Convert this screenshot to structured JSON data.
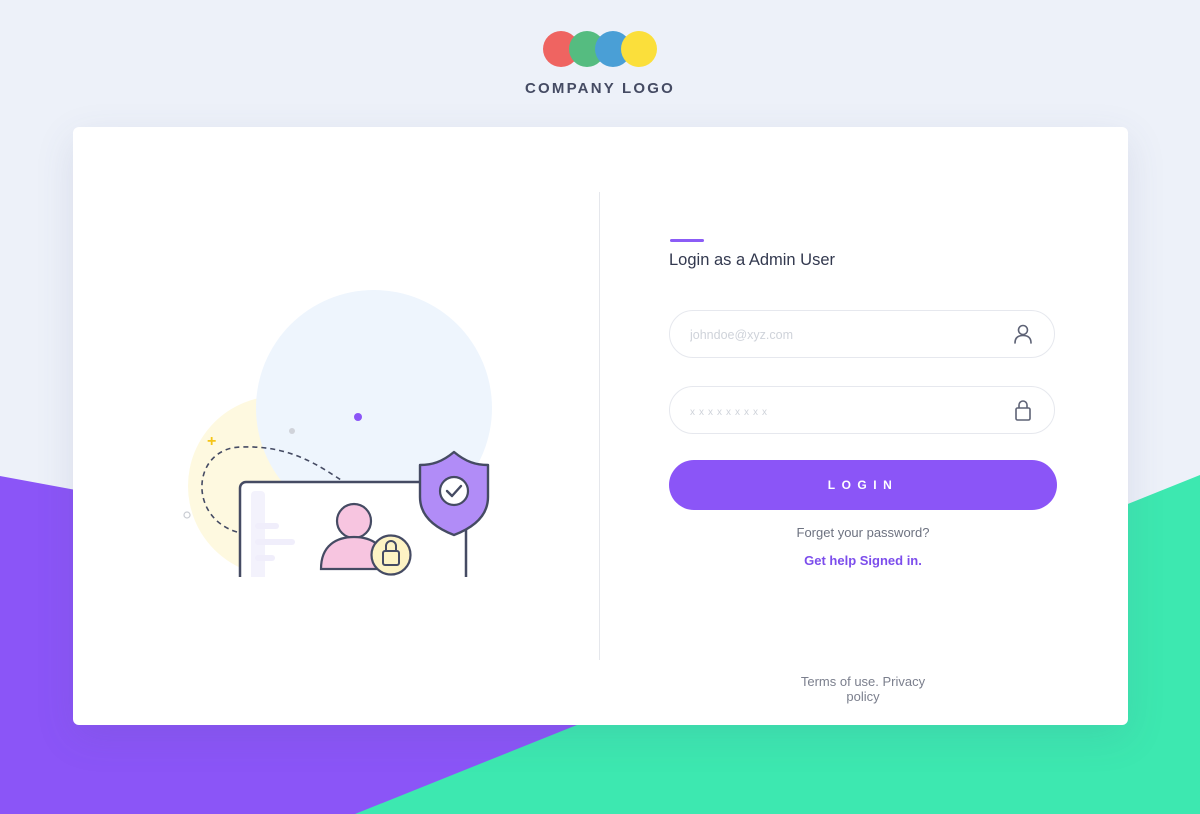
{
  "logo": {
    "text": "COMPANY LOGO",
    "dot_colors": [
      "#ef6461",
      "#55bc80",
      "#4a9fd6",
      "#fbdf3b"
    ]
  },
  "login_form": {
    "title": "Login as a Admin User",
    "email_placeholder": "johndoe@xyz.com",
    "password_placeholder": "xxxxxxxxx",
    "email_icon": "user-icon",
    "password_icon": "lock-icon",
    "login_button_label": "LOGIN",
    "forgot_password_text": "Forget your password?",
    "help_link_text": "Get help Signed in."
  },
  "footer": {
    "terms_label": "Terms of use.",
    "privacy_label": "Privacy policy"
  },
  "colors": {
    "accent_purple": "#8b55f7",
    "accent_green": "#3de8b0",
    "background": "#edf1f9"
  },
  "illustration": {
    "icons": [
      "monitor-icon",
      "shield-check-icon",
      "user-avatar-icon",
      "lock-icon"
    ]
  }
}
